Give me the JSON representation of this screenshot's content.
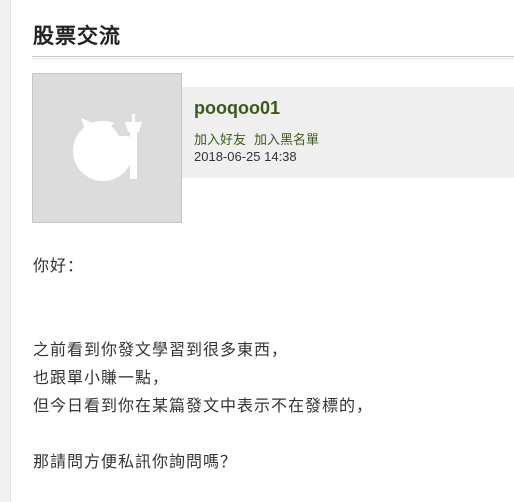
{
  "header": {
    "title": "股票交流"
  },
  "user": {
    "avatar_icon": "default-avatar-icon",
    "name": "pooqoo01",
    "add_friend_label": "加入好友",
    "add_blacklist_label": "加入黑名單",
    "post_time": "2018-06-25 14:38"
  },
  "post": {
    "lines": [
      "你好：",
      "",
      "",
      "之前看到你發文學習到很多東西，",
      "也跟單小賺一點，",
      "但今日看到你在某篇發文中表示不在發標的，",
      "",
      "那請問方便私訊你詢問嗎？"
    ]
  },
  "colors": {
    "accent_green": "#3b5a1a",
    "avatar_bg": "#dcdcdc",
    "band_bg": "#efefef"
  }
}
